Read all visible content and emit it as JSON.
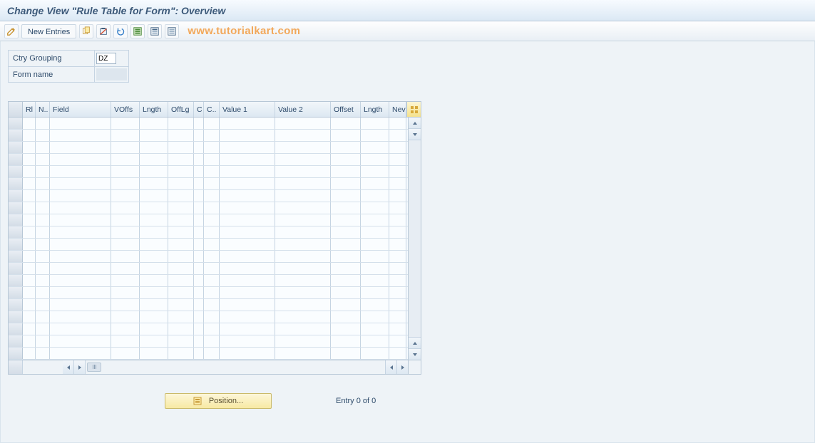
{
  "title": "Change View \"Rule Table for Form\": Overview",
  "toolbar": {
    "new_entries": "New Entries",
    "watermark": "www.tutorialkart.com"
  },
  "form": {
    "ctry_grouping_label": "Ctry Grouping",
    "ctry_grouping_value": "DZ",
    "form_name_label": "Form name",
    "form_name_value": ""
  },
  "table": {
    "columns": {
      "rl": "Rl",
      "n": "N..",
      "field": "Field",
      "voffs": "VOffs",
      "lngth": "Lngth",
      "offlg": "OffLg",
      "c1": "C",
      "c2": "C..",
      "value1": "Value 1",
      "value2": "Value 2",
      "offset": "Offset",
      "lngth2": "Lngth",
      "nev": "Nev"
    },
    "rows": []
  },
  "footer": {
    "position_label": "Position...",
    "entry_text": "Entry 0 of 0"
  }
}
